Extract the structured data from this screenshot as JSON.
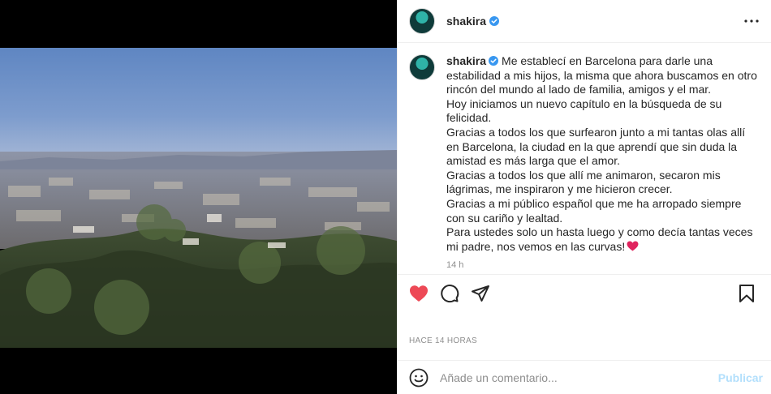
{
  "post": {
    "username": "shakira",
    "verified_icon": "verified-badge-icon",
    "more_icon": "more-options-icon",
    "caption": {
      "username": "shakira",
      "text": "Me establecí en Barcelona para darle una estabilidad a mis hijos, la misma que ahora buscamos en otro rincón del mundo al lado de familia, amigos y el mar.\nHoy iniciamos un nuevo capítulo en la búsqueda de su felicidad.\nGracias a todos los que surfearon junto a mi tantas olas allí en Barcelona, la ciudad en la que aprendí que sin duda la amistad es más larga que el amor.\nGracias a todos los que allí me animaron, secaron mis lágrimas, me inspiraron y me hicieron crecer.\nGracias a mi público español que me ha arropado siempre con su cariño y lealtad.\nPara ustedes solo un hasta luego y como decía tantas veces mi padre, nos vemos en las curvas!",
      "time": "14 h"
    },
    "actions": {
      "like_icon": "heart-filled-icon",
      "comment_icon": "comment-icon",
      "share_icon": "share-icon",
      "save_icon": "bookmark-icon"
    },
    "date_label": "HACE 14 HORAS",
    "composer": {
      "emoji_icon": "emoji-icon",
      "placeholder": "Añade un comentario...",
      "publish_label": "Publicar"
    },
    "colors": {
      "like": "#ed4956",
      "verified": "#3897f0",
      "publish_disabled": "#b2dffc"
    }
  }
}
